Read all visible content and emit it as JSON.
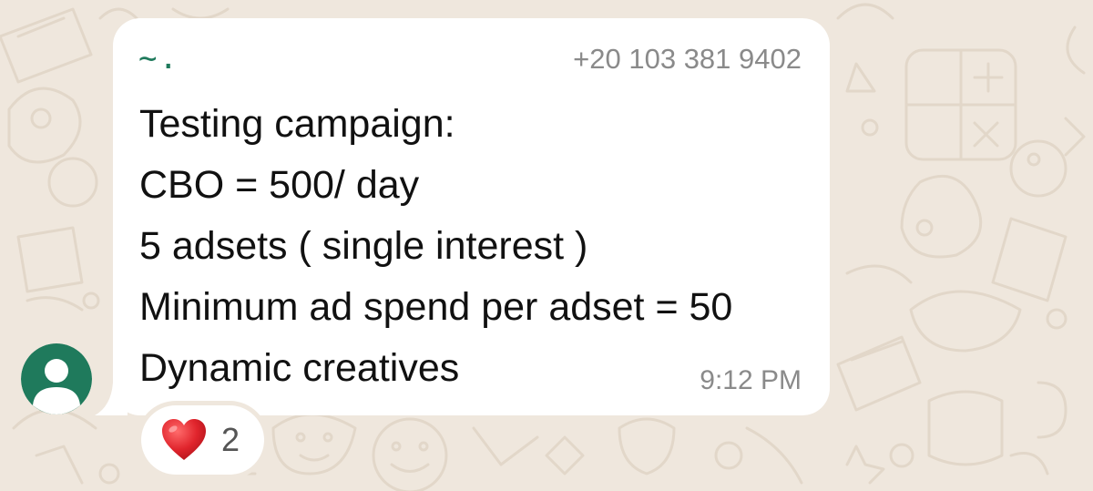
{
  "message": {
    "sender_name": "~.",
    "sender_phone": "+20 103 381 9402",
    "lines": [
      "Testing campaign:",
      "CBO = 500/ day",
      "5 adsets ( single interest )",
      "Minimum ad spend per adset = 50",
      "Dynamic creatives"
    ],
    "time": "9:12 PM"
  },
  "reaction": {
    "emoji": "heart-icon",
    "count": "2"
  },
  "colors": {
    "background": "#efe7dd",
    "bubble": "#ffffff",
    "sender_name": "#1f7a5c",
    "avatar": "#1f7a5c",
    "secondary_text": "#8a8a8a",
    "heart": "#e0242c"
  }
}
